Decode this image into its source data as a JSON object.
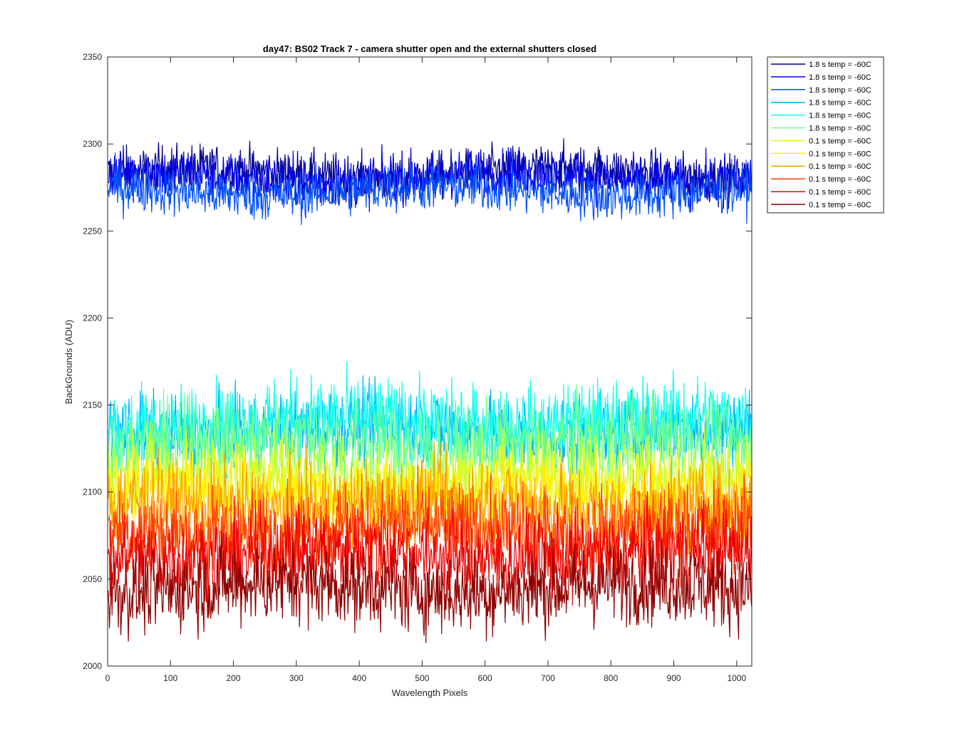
{
  "chart_data": {
    "type": "line",
    "title": "day47: BS02  Track 7 - camera shutter open and the external shutters closed",
    "xlabel": "Wavelength Pixels",
    "ylabel": "BackGrounds (ADU)",
    "xlim": [
      0,
      1024
    ],
    "ylim": [
      2000,
      2350
    ],
    "xticks": [
      0,
      100,
      200,
      300,
      400,
      500,
      600,
      700,
      800,
      900,
      1000
    ],
    "yticks": [
      2000,
      2050,
      2100,
      2150,
      2200,
      2250,
      2300,
      2350
    ],
    "grid": false,
    "legend_position": "outside-top-right",
    "n_points": 1024,
    "series": [
      {
        "name": "1.8 s temp = -60C",
        "color": "#00008f",
        "mean": 2283,
        "noise": 7
      },
      {
        "name": "1.8 s temp = -60C",
        "color": "#0000ef",
        "mean": 2281,
        "noise": 7
      },
      {
        "name": "1.8 s temp = -60C",
        "color": "#0050ff",
        "mean": 2273,
        "noise": 7
      },
      {
        "name": "1.8 s temp = -60C",
        "color": "#00afff",
        "mean": 2135,
        "noise": 11
      },
      {
        "name": "1.8 s temp = -60C",
        "color": "#10ffef",
        "mean": 2140,
        "noise": 12
      },
      {
        "name": "1.8 s temp = -60C",
        "color": "#70ff8f",
        "mean": 2128,
        "noise": 12
      },
      {
        "name": "0.1 s temp = -60C",
        "color": "#cfff30",
        "mean": 2110,
        "noise": 12
      },
      {
        "name": "0.1 s temp = -60C",
        "color": "#ffef00",
        "mean": 2100,
        "noise": 12
      },
      {
        "name": "0.1 s temp = -60C",
        "color": "#ff9f00",
        "mean": 2092,
        "noise": 13
      },
      {
        "name": "0.1 s temp = -60C",
        "color": "#ff4000",
        "mean": 2078,
        "noise": 13
      },
      {
        "name": "0.1 s temp = -60C",
        "color": "#ef0000",
        "mean": 2064,
        "noise": 13
      },
      {
        "name": "0.1 s temp = -60C",
        "color": "#8f0000",
        "mean": 2045,
        "noise": 12
      }
    ]
  }
}
